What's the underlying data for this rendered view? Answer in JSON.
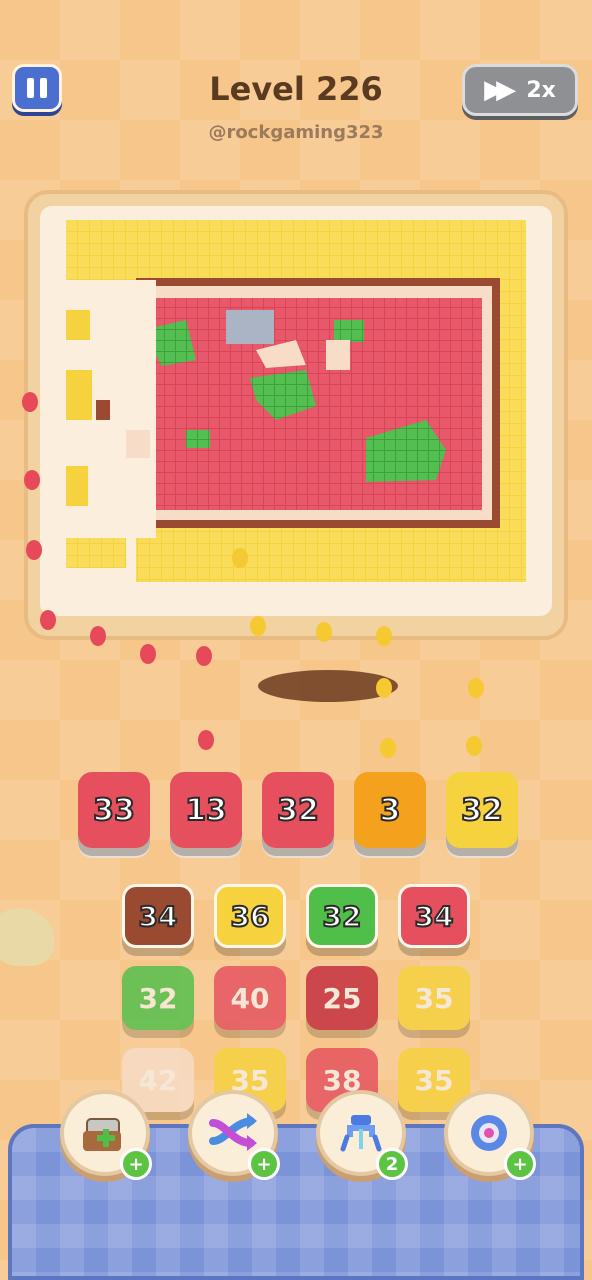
{
  "header": {
    "level_title": "Level 226",
    "handle": "@rockgaming323",
    "speed_label": "2x"
  },
  "colors": {
    "red": "#e6505e",
    "yellow": "#f6d23e",
    "orange": "#f4a21e",
    "green": "#4fbf4a",
    "brown": "#9b4a32",
    "darkred": "#c32b3c",
    "cream": "#f7dcc8",
    "blue": "#5b78d2"
  },
  "slots": [
    {
      "value": "33",
      "color": "red"
    },
    {
      "value": "13",
      "color": "red"
    },
    {
      "value": "32",
      "color": "red"
    },
    {
      "value": "3",
      "color": "orange"
    },
    {
      "value": "32",
      "color": "yellow"
    }
  ],
  "tiles": [
    {
      "value": "34",
      "color": "brown",
      "state": "active"
    },
    {
      "value": "36",
      "color": "yellow",
      "state": "active"
    },
    {
      "value": "32",
      "color": "green",
      "state": "active"
    },
    {
      "value": "34",
      "color": "red",
      "state": "active"
    },
    {
      "value": "32",
      "color": "green",
      "state": "dim"
    },
    {
      "value": "40",
      "color": "red",
      "state": "dim"
    },
    {
      "value": "25",
      "color": "darkred",
      "state": "dim"
    },
    {
      "value": "35",
      "color": "yellow",
      "state": "dim"
    },
    {
      "value": "42",
      "color": "cream",
      "state": "dim"
    },
    {
      "value": "35",
      "color": "yellow",
      "state": "dim"
    },
    {
      "value": "38",
      "color": "red",
      "state": "dim"
    },
    {
      "value": "35",
      "color": "yellow",
      "state": "dim"
    }
  ],
  "boosters": [
    {
      "name": "add-box-booster",
      "icon": "box-plus-icon",
      "badge": "+"
    },
    {
      "name": "shuffle-booster",
      "icon": "shuffle-arrows-icon",
      "badge": "+"
    },
    {
      "name": "magnet-booster",
      "icon": "magnet-claw-icon",
      "badge": "2"
    },
    {
      "name": "bomb-booster",
      "icon": "blue-bomb-icon",
      "badge": "+"
    }
  ]
}
